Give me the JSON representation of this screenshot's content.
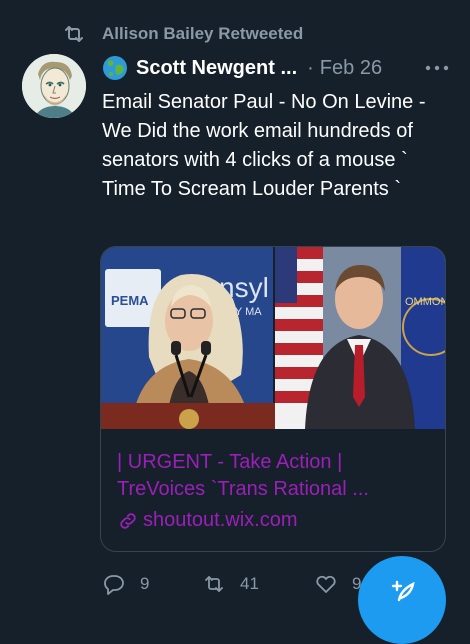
{
  "retweet": {
    "label": "Allison Bailey Retweeted"
  },
  "tweet": {
    "author_name": "Scott Newgent ...",
    "separator": "·",
    "date": "Feb 26",
    "text": "Email Senator Paul - No On Levine - We Did the work email hundreds of senators with 4 clicks of a mouse ` Time To Scream Louder Parents `"
  },
  "card": {
    "title_line1": "| URGENT - Take Action |",
    "title_line2": "TreVoices `Trans Rational ...",
    "link": "shoutout.wix.com",
    "image_text_pema": "PEMA",
    "image_text_sign": "nsyl",
    "image_text_sign2": "NCY MA",
    "image_text_seal": "OMMONWE"
  },
  "actions": {
    "replies": "9",
    "retweets": "41",
    "likes": "9"
  },
  "colors": {
    "background": "#15202b",
    "muted": "#8b98a5",
    "link": "#9b1fb8",
    "accent": "#1d9bf0"
  },
  "icons": {
    "retweet": "retweet-icon",
    "globe": "globe-emoji-icon",
    "more": "more-horizontal-icon",
    "link": "link-icon",
    "reply": "reply-icon",
    "like": "heart-icon",
    "compose": "compose-feather-icon"
  }
}
